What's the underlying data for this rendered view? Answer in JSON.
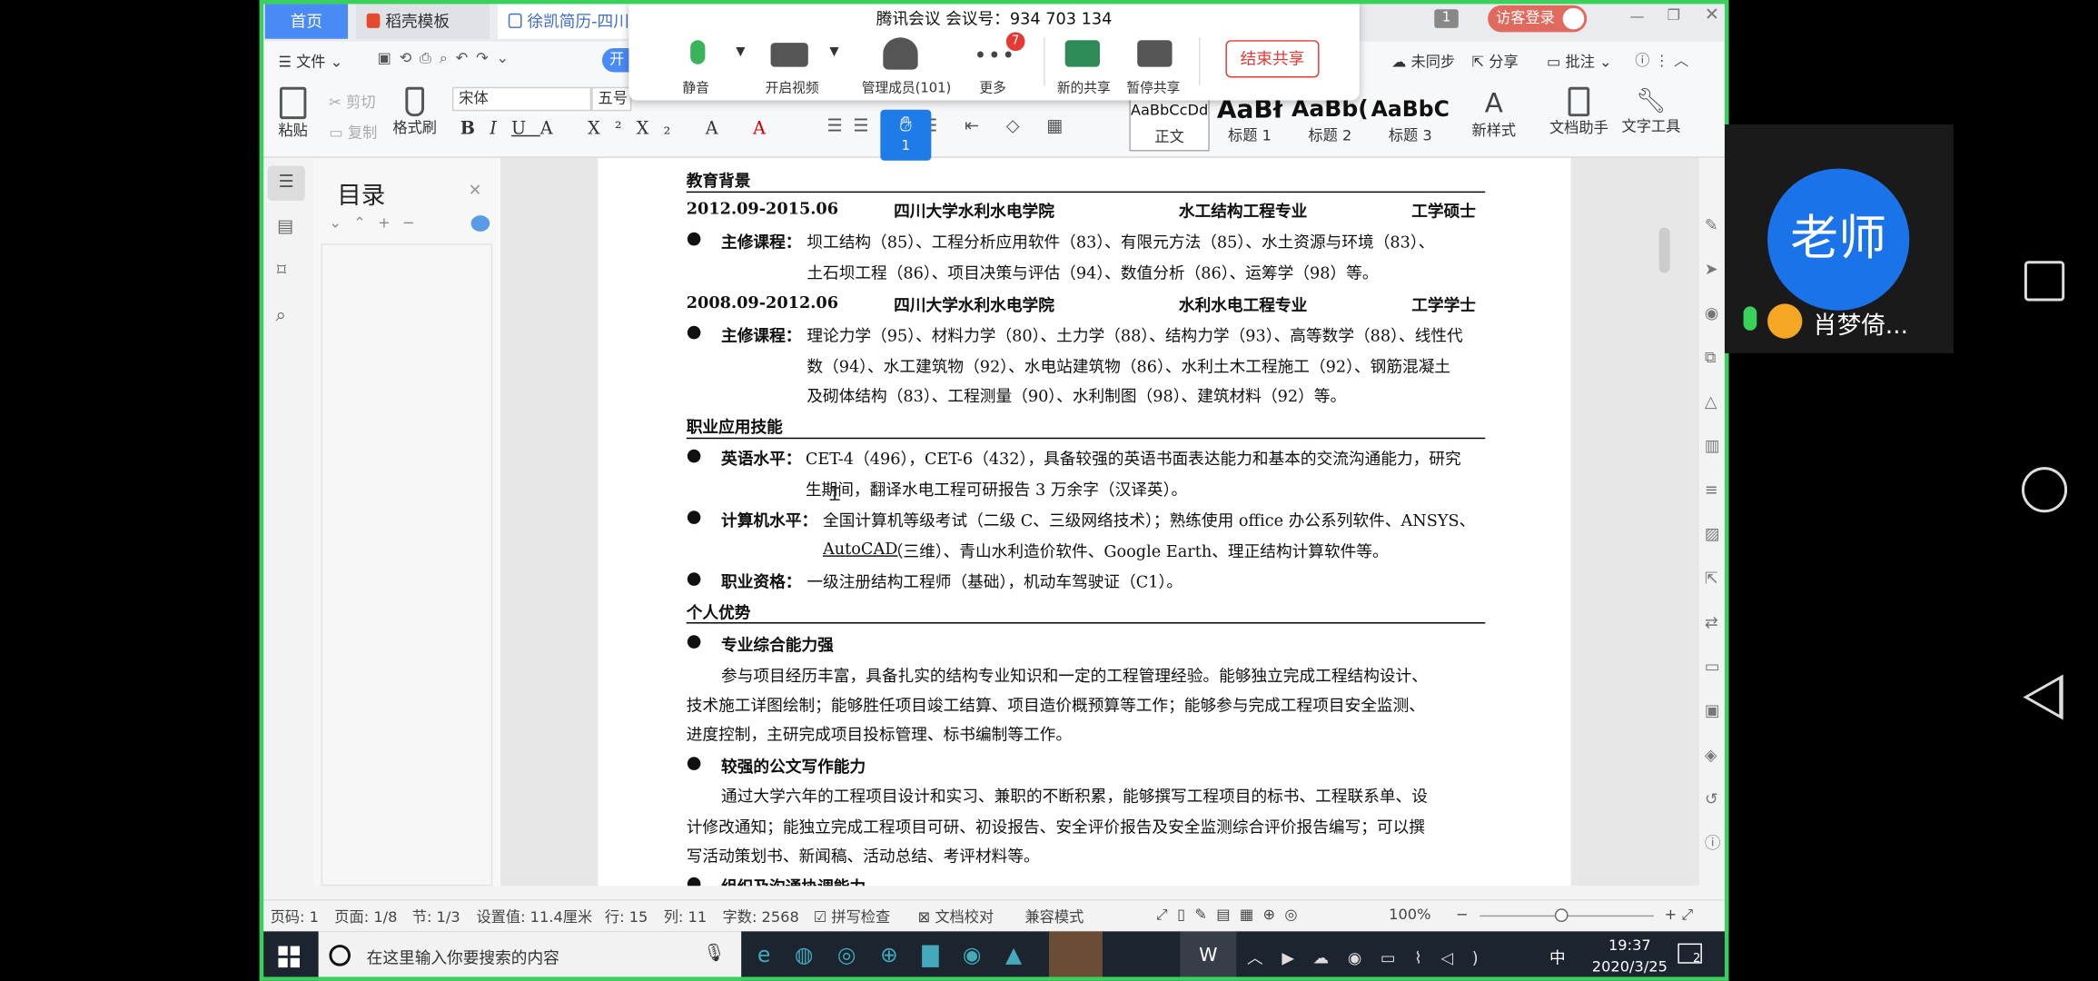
{
  "tabs": {
    "home": "首页",
    "templates": "稻壳模板",
    "doc": "徐凯简历-四川大"
  },
  "tabbar_right": {
    "badge": "1",
    "login": "访客登录"
  },
  "cmdbar": {
    "file": "文件",
    "kai": "开",
    "sync": "未同步",
    "share": "分享",
    "comment": "批注"
  },
  "ribbon": {
    "paste": "粘贴",
    "cut": "剪切",
    "copy": "复制",
    "format_painter": "格式刷",
    "font": "宋体",
    "size": "五号",
    "styles": [
      {
        "preview": "AaBbCcDd",
        "label": "正文"
      },
      {
        "preview": "AaBł",
        "label": "标题 1"
      },
      {
        "preview": "AaBb(",
        "label": "标题 2"
      },
      {
        "preview": "AaBbC",
        "label": "标题 3"
      }
    ],
    "new_style": "新样式",
    "doc_assistant": "文档助手",
    "text_tools": "文字工具"
  },
  "meeting": {
    "title": "腾讯会议 会议号：934 703 134",
    "mute": "静音",
    "video": "开启视频",
    "members": "管理成员(101)",
    "more": "更多",
    "more_badge": "7",
    "new_share": "新的共享",
    "pause_share": "暂停共享",
    "end_share": "结束共享",
    "hand_count": "1"
  },
  "toc": {
    "title": "目录"
  },
  "doc": {
    "edu_title": "教育背景",
    "edu1": {
      "date": "2012.09-2015.06",
      "school": "四川大学水利水电学院",
      "major": "水工结构工程专业",
      "degree": "工学硕士"
    },
    "edu1_course_label": "主修课程：",
    "edu1_course_l1": "坝工结构（85）、工程分析应用软件（83）、有限元方法（85）、水土资源与环境（83）、",
    "edu1_course_l2": "土石坝工程（86）、项目决策与评估（94）、数值分析（86）、运筹学（98）等。",
    "edu2": {
      "date": "2008.09-2012.06",
      "school": "四川大学水利水电学院",
      "major": "水利水电工程专业",
      "degree": "工学学士"
    },
    "edu2_course_label": "主修课程：",
    "edu2_course_l1": "理论力学（95）、材料力学（80）、土力学（88）、结构力学（93）、高等数学（88）、线性代",
    "edu2_course_l2": "数（94）、水工建筑物（92）、水电站建筑物（86）、水利土木工程施工（92）、钢筋混凝土",
    "edu2_course_l3": "及砌体结构（83）、工程测量（90）、水利制图（98）、建筑材料（92）等。",
    "skills_title": "职业应用技能",
    "eng_label": "英语水平：",
    "eng_l1": "CET-4（496），CET-6（432），具备较强的英语书面表达能力和基本的交流沟通能力，研究",
    "eng_l2": "生期间，翻译水电工程可研报告 3 万余字（汉译英）。",
    "comp_label": "计算机水平：",
    "comp_l1": "全国计算机等级考试（二级 C、三级网络技术）；熟练使用 office 办公系列软件、ANSYS、",
    "comp_l2a": "AutoCAD",
    "comp_l2b": "（三维）、青山水利造价软件、Google Earth、理正结构计算软件等。",
    "qual_label": "职业资格：",
    "qual_text": "一级注册结构工程师（基础），机动车驾驶证（C1）。",
    "adv_title": "个人优势",
    "adv1_title": "专业综合能力强",
    "adv1_l1": "参与项目经历丰富，具备扎实的结构专业知识和一定的工程管理经验。能够独立完成工程结构设计、",
    "adv1_l2": "技术施工详图绘制；能够胜任项目竣工结算、项目造价概预算等工作；能够参与完成工程项目安全监测、",
    "adv1_l3": "进度控制，主研完成项目投标管理、标书编制等工作。",
    "adv2_title": "较强的公文写作能力",
    "adv2_l1": "通过大学六年的工程项目设计和实习、兼职的不断积累，能够撰写工程项目的标书、工程联系单、设",
    "adv2_l2": "计修改通知；能独立完成工程项目可研、初设报告、安全评价报告及安全监测综合评价报告编写；可以撰",
    "adv2_l3": "写活动策划书、新闻稿、活动总结、考评材料等。",
    "adv3_title": "组织及沟通协调能力"
  },
  "status": {
    "page_code": "页码: 1",
    "page": "页面: 1/8",
    "section": "节: 1/3",
    "setting": "设置值: 11.4厘米",
    "row": "行: 15",
    "col": "列: 11",
    "words": "字数: 2568",
    "spell": "拼写检查",
    "proof": "文档校对",
    "compat": "兼容模式",
    "zoom": "100%"
  },
  "taskbar": {
    "search": "在这里输入你要搜索的内容",
    "ime": "中",
    "time": "19:37",
    "date": "2020/3/25",
    "notif": "2"
  },
  "tile": {
    "avatar": "老师",
    "name": "肖梦倚..."
  }
}
